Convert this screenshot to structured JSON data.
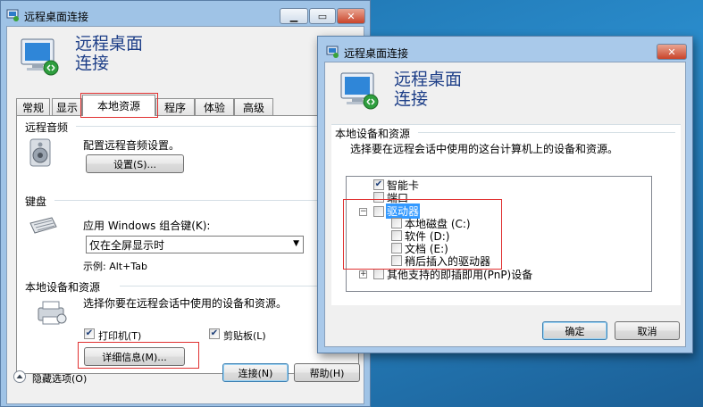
{
  "window1": {
    "title": "远程桌面连接",
    "header_line1": "远程桌面",
    "header_line2": "连接",
    "tabs": [
      {
        "label": "常规"
      },
      {
        "label": "显示"
      },
      {
        "label": "本地资源"
      },
      {
        "label": "程序"
      },
      {
        "label": "体验"
      },
      {
        "label": "高级"
      }
    ],
    "audio": {
      "group": "远程音频",
      "desc": "配置远程音频设置。",
      "button": "设置(S)..."
    },
    "keyboard": {
      "group": "键盘",
      "desc": "应用 Windows 组合键(K):",
      "selected": "仅在全屏显示时",
      "example": "示例: Alt+Tab"
    },
    "devices": {
      "group": "本地设备和资源",
      "desc": "选择你要在远程会话中使用的设备和资源。",
      "printer": "打印机(T)",
      "clipboard": "剪贴板(L)",
      "details_button": "详细信息(M)..."
    },
    "footer": {
      "hide_options": "隐藏选项(O)",
      "connect": "连接(N)",
      "help": "帮助(H)"
    }
  },
  "window2": {
    "title": "远程桌面连接",
    "header_line1": "远程桌面",
    "header_line2": "连接",
    "group": "本地设备和资源",
    "desc": "选择要在远程会话中使用的这台计算机上的设备和资源。",
    "tree": {
      "smartcard": "智能卡",
      "ports": "端口",
      "drives": "驱动器",
      "drive_c": "本地磁盘 (C:)",
      "drive_d": "软件 (D:)",
      "drive_e": "文档 (E:)",
      "later_drives": "稍后插入的驱动器",
      "pnp": "其他支持的即插即用(PnP)设备"
    },
    "ok": "确定",
    "cancel": "取消"
  },
  "colors": {
    "title_blue": "#1e3f88",
    "highlight_red": "#e03131",
    "selection_blue": "#3399ff"
  }
}
